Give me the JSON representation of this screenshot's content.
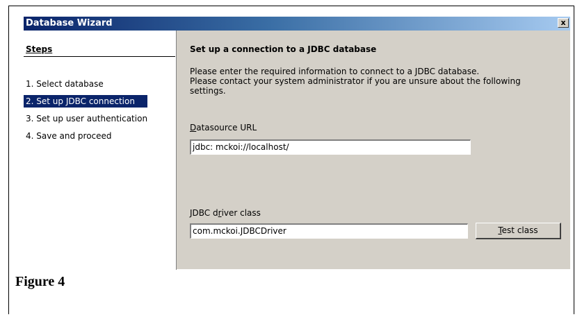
{
  "window": {
    "title": "Database Wizard",
    "close_label": "x"
  },
  "steps": {
    "title": "Steps",
    "items": [
      {
        "label": "1.  Select database"
      },
      {
        "label": "2.  Set up JDBC connection"
      },
      {
        "label": "3.  Set up user authentication"
      },
      {
        "label": "4.  Save and proceed"
      }
    ]
  },
  "main": {
    "heading": "Set up a connection to a JDBC database",
    "description_line1": "Please enter the required information to connect to a JDBC database.",
    "description_line2": "Please contact your system administrator if you are unsure about the following",
    "description_line3": "settings.",
    "datasource_label_mnemonic": "D",
    "datasource_label_rest": "atasource URL",
    "datasource_prefix": "jdbc:",
    "datasource_value": "mckoi://localhost/",
    "driver_label_pre": "JDBC d",
    "driver_label_mnemonic": "r",
    "driver_label_post": "iver class",
    "driver_value": "com.mckoi.JDBCDriver",
    "test_button_mnemonic": "T",
    "test_button_rest": "est class"
  },
  "caption": "Figure 4"
}
